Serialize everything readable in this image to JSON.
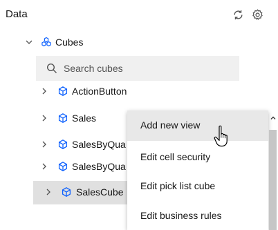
{
  "panel": {
    "title": "Data",
    "refresh_icon": "refresh-icon",
    "settings_icon": "gear-icon"
  },
  "tree": {
    "root": {
      "label": "Cubes",
      "icon": "cubes-group-icon",
      "expanded": true
    },
    "search": {
      "placeholder": "Search cubes",
      "value": ""
    },
    "items": [
      {
        "label": "ActionButton",
        "icon": "cube-icon"
      },
      {
        "label": "Sales",
        "icon": "cube-icon"
      },
      {
        "label": "SalesByQua",
        "icon": "cube-icon"
      },
      {
        "label": "SalesByQua",
        "icon": "cube-icon"
      },
      {
        "label": "SalesCube",
        "icon": "cube-icon",
        "selected": true
      }
    ]
  },
  "context_menu": {
    "items": [
      {
        "label": "Add new view",
        "hovered": true
      },
      {
        "label": "Edit cell security"
      },
      {
        "label": "Edit pick list cube"
      },
      {
        "label": "Edit business rules"
      }
    ]
  },
  "colors": {
    "accent": "#0f62fe",
    "icon_gray": "#525252",
    "search_bg": "#f0f0f0",
    "selected_row": "#e0e0e0",
    "scrollbar": "#c6c6c6"
  }
}
